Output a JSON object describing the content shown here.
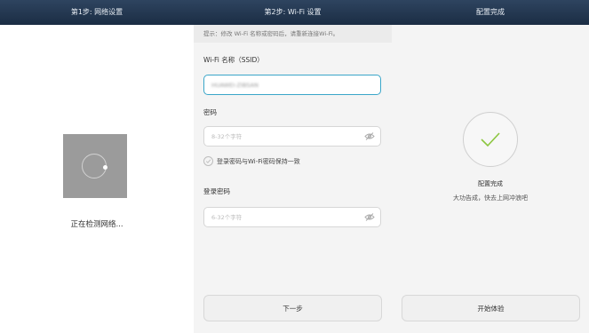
{
  "step1": {
    "header": "第1步: 网络设置",
    "status": "正在检测网络..."
  },
  "step2": {
    "header": "第2步: Wi-Fi 设置",
    "tip": "提示：修改 Wi-Fi 名称或密码后，请重新连接Wi-Fi。",
    "ssid_label": "Wi-Fi 名称（SSID）",
    "ssid_value": "HUAWEI-ZIBSAN",
    "password_label": "密码",
    "password_placeholder": "8-32个字符",
    "sync_checkbox_label": "登录密码与Wi-Fi密码保持一致",
    "login_password_label": "登录密码",
    "login_password_placeholder": "6-32个字符",
    "next_button": "下一步"
  },
  "step3": {
    "header": "配置完成",
    "title": "配置完成",
    "subtitle": "大功告成，快去上网冲浪吧",
    "start_button": "开始体验"
  },
  "colors": {
    "header_bg": "#1f3149",
    "accent": "#3aa6c9",
    "success_check": "#8cc63f"
  },
  "icons": [
    "eye-hidden-icon",
    "checkmark-icon",
    "spinner-icon",
    "circle-check-icon"
  ]
}
